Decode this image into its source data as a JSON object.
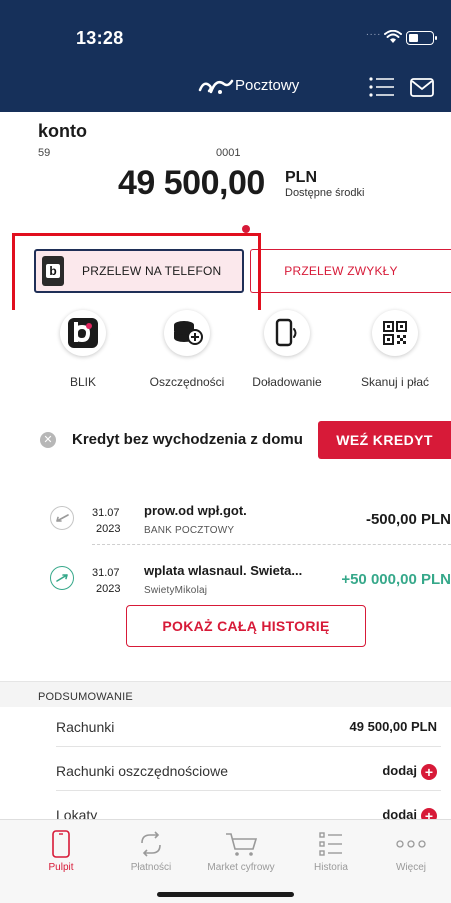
{
  "status_bar": {
    "time": "13:28",
    "signal": "....",
    "icons": [
      "wifi-icon",
      "battery-icon"
    ]
  },
  "top_bar": {
    "brand": "Pocztowy",
    "icons": [
      "pocztowy-logo",
      "list-icon",
      "mail-icon"
    ]
  },
  "account": {
    "name": "konto",
    "number_left": "59",
    "number_right": "0001",
    "balance": "49 500,00",
    "currency": "PLN",
    "available_label": "Dostępne środki"
  },
  "transfers": {
    "phone_label": "PRZELEW NA TELEFON",
    "regular_label": "PRZELEW ZWYKŁY"
  },
  "quick_actions": [
    {
      "label": "BLIK",
      "icon": "blik-icon"
    },
    {
      "label": "Oszczędności",
      "icon": "coins-icon"
    },
    {
      "label": "Doładowanie",
      "icon": "phone-topup-icon"
    },
    {
      "label": "Skanuj i płać",
      "icon": "qr-code-icon"
    }
  ],
  "credit_banner": {
    "text": "Kredyt bez wychodzenia z domu",
    "button": "WEŹ KREDYT"
  },
  "transactions": [
    {
      "day": "31.07",
      "year": "2023",
      "title": "prow.od wpł.got.",
      "subtitle": "BANK POCZTOWY",
      "amount": "-500,00 PLN",
      "direction": "outgoing"
    },
    {
      "day": "31.07",
      "year": "2023",
      "title": "wplata wlasnaul. Swieta...",
      "subtitle": "SwietyMikolaj",
      "amount": "+50 000,00 PLN",
      "direction": "incoming"
    }
  ],
  "history_button": "POKAŻ CAŁĄ HISTORIĘ",
  "summary": {
    "header": "PODSUMOWANIE",
    "rows": [
      {
        "label": "Rachunki",
        "value": "49 500,00 PLN"
      },
      {
        "label": "Rachunki oszczędnościowe",
        "value": "dodaj"
      },
      {
        "label": "Lokaty",
        "value": "dodaj"
      }
    ]
  },
  "tabs": [
    {
      "label": "Pulpit",
      "icon": "phone-icon",
      "active": true
    },
    {
      "label": "Płatności",
      "icon": "payments-icon",
      "active": false
    },
    {
      "label": "Market cyfrowy",
      "icon": "cart-icon",
      "active": false
    },
    {
      "label": "Historia",
      "icon": "history-icon",
      "active": false
    },
    {
      "label": "Więcej",
      "icon": "more-icon",
      "active": false
    }
  ],
  "colors": {
    "navy": "#16305a",
    "accent_red": "#d71a38",
    "incoming_green": "#36a88a",
    "highlight_red": "#e10f1e"
  }
}
